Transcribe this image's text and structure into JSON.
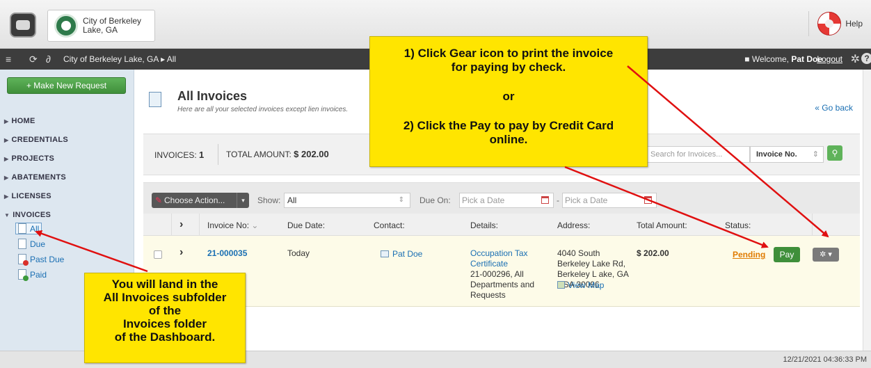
{
  "header": {
    "city_name": "City of Berkeley Lake, GA",
    "help_label": "Help"
  },
  "navbar": {
    "breadcrumb": "City of Berkeley Lake, GA ▸ All",
    "welcome_prefix": "■ Welcome,",
    "user_name": "Pat Doe",
    "logout_label": "Logout"
  },
  "sidebar": {
    "new_request_label": "+ Make New Request",
    "menu": [
      "HOME",
      "CREDENTIALS",
      "PROJECTS",
      "ABATEMENTS",
      "LICENSES",
      "INVOICES"
    ],
    "invoice_subitems": [
      "All",
      "Due",
      "Past Due",
      "Paid"
    ]
  },
  "page": {
    "title": "All Invoices",
    "subtitle": "Here are all your selected invoices except lien invoices.",
    "go_back": "« Go back"
  },
  "summary": {
    "invoices_label": "INVOICES:",
    "invoices_count": "1",
    "total_label": "TOTAL AMOUNT:",
    "total_value": "$ 202.00",
    "search_placeholder": "Search for Invoices...",
    "search_field": "Invoice No."
  },
  "filters": {
    "choose_action": "Choose Action...",
    "show_label": "Show:",
    "show_value": "All",
    "due_on_label": "Due On:",
    "date_placeholder": "Pick a Date",
    "dash": "-"
  },
  "table": {
    "headers": [
      "Invoice No:",
      "Due Date:",
      "Contact:",
      "Details:",
      "Address:",
      "Total Amount:",
      "Status:"
    ],
    "row": {
      "invoice_no": "21-000035",
      "due_date": "Today",
      "contact": "Pat Doe",
      "details_link": "Occupation Tax Certificate",
      "details_text": "21-000296, All Departments and Requests",
      "address": "4040 South Berkeley Lake Rd, Berkeley L ake, GA USA 30096",
      "view_map": "View Map",
      "total_amount": "$ 202.00",
      "status": "Pending",
      "pay_label": "Pay"
    }
  },
  "footer": {
    "timestamp": "12/21/2021 04:36:33 PM"
  },
  "annotations": {
    "top_line1": "1) Click Gear icon to print the invoice",
    "top_line2": "for paying by check.",
    "top_or": "or",
    "top_line3": "2) Click the Pay to pay by Credit Card",
    "top_line4": "online.",
    "left_lines": [
      "You will land in the",
      "All Invoices subfolder",
      "of the",
      "Invoices folder",
      "of the Dashboard."
    ]
  },
  "colors": {
    "arrow": "#e01010",
    "callout": "#ffe500",
    "pay_green": "#3f8f3a",
    "pending_orange": "#e07b00",
    "link_blue": "#1a6fb3"
  }
}
